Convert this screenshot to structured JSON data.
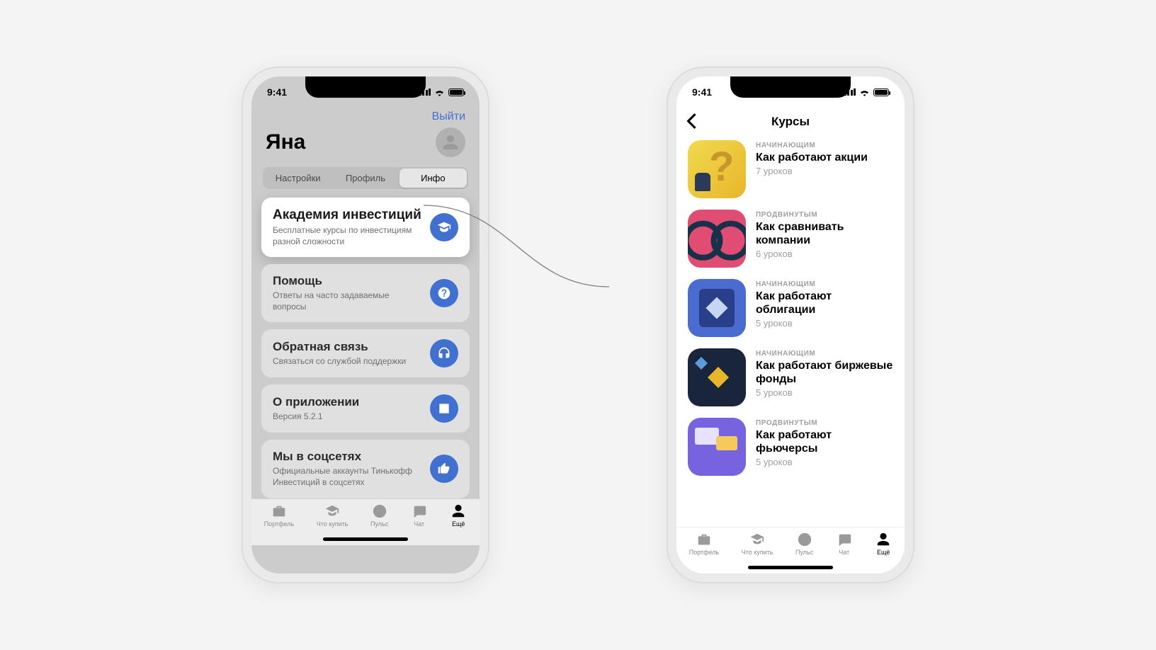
{
  "status": {
    "time": "9:41"
  },
  "left": {
    "logout": "Выйти",
    "name": "Яна",
    "tabs": {
      "settings": "Настройки",
      "profile": "Профиль",
      "info": "Инфо"
    },
    "cards": {
      "academy": {
        "title": "Академия инвестиций",
        "sub": "Бесплатные курсы по инвестициям разной сложности"
      },
      "help": {
        "title": "Помощь",
        "sub": "Ответы на часто задаваемые вопросы"
      },
      "feedback": {
        "title": "Обратная связь",
        "sub": "Связаться со службой поддержки"
      },
      "about": {
        "title": "О приложении",
        "sub": "Версия 5.2.1"
      },
      "social": {
        "title": "Мы в соцсетях",
        "sub": "Официальные аккаунты Тинькофф Инвестиций в соцсетях"
      }
    }
  },
  "right": {
    "title": "Курсы",
    "courses": [
      {
        "tag": "НАЧИНАЮЩИМ",
        "title": "Как работают акции",
        "meta": "7 уроков"
      },
      {
        "tag": "ПРОДВИНУТЫМ",
        "title": "Как сравнивать компании",
        "meta": "6 уроков"
      },
      {
        "tag": "НАЧИНАЮЩИМ",
        "title": "Как работают облигации",
        "meta": "5 уроков"
      },
      {
        "tag": "НАЧИНАЮЩИМ",
        "title": "Как работают биржевые фонды",
        "meta": "5 уроков"
      },
      {
        "tag": "ПРОДВИНУТЫМ",
        "title": "Как работают фьючерсы",
        "meta": "5 уроков"
      }
    ]
  },
  "tabs": {
    "portfolio": "Портфель",
    "buy": "Что купить",
    "pulse": "Пульс",
    "chat": "Чат",
    "more": "Ещё"
  }
}
